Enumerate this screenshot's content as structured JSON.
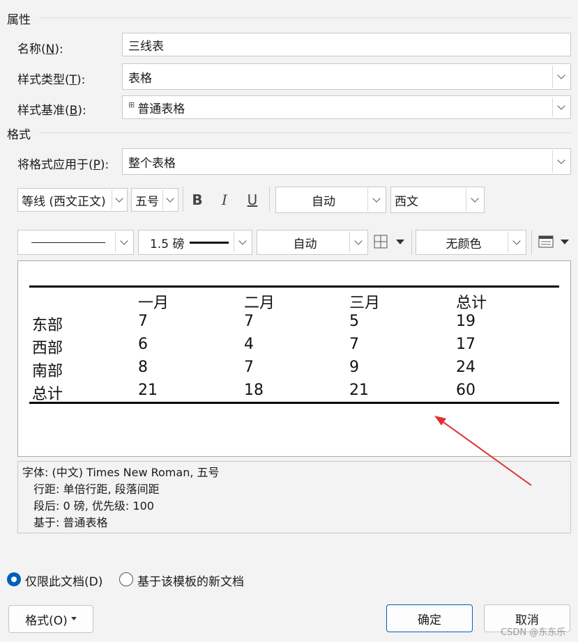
{
  "properties": {
    "section_title": "属性",
    "name_label_pre": "名称(",
    "name_label_key": "N",
    "name_label_post": "):",
    "name_value": "三线表",
    "type_label_pre": "样式类型(",
    "type_label_key": "T",
    "type_label_post": "):",
    "type_value": "表格",
    "based_label_pre": "样式基准(",
    "based_label_key": "B",
    "based_label_post": "):",
    "based_value": "普通表格"
  },
  "format": {
    "section_title": "格式",
    "apply_label_pre": "将格式应用于(",
    "apply_label_key": "P",
    "apply_label_post": "):",
    "apply_value": "整个表格",
    "font_name": "等线 (西文正文)",
    "font_size": "五号",
    "bold": "B",
    "italic": "I",
    "underline": "U",
    "font_color": "自动",
    "script": "西文",
    "border_width": "1.5 磅",
    "border_color": "自动",
    "shading": "无颜色"
  },
  "preview_table": {
    "headers": [
      "",
      "一月",
      "二月",
      "三月",
      "总计"
    ],
    "rows": [
      [
        "东部",
        "7",
        "7",
        "5",
        "19"
      ],
      [
        "西部",
        "6",
        "4",
        "7",
        "17"
      ],
      [
        "南部",
        "8",
        "7",
        "9",
        "24"
      ],
      [
        "总计",
        "21",
        "18",
        "21",
        "60"
      ]
    ]
  },
  "description": {
    "line1": "字体: (中文) Times New Roman, 五号",
    "line2": "行距: 单倍行距, 段落间距",
    "line3": "段后: 0 磅, 优先级: 100",
    "line4": "基于: 普通表格"
  },
  "scope": {
    "option1": "仅限此文档(D)",
    "option2": "基于该模板的新文档",
    "selected": "option1"
  },
  "buttons": {
    "format": "格式(O)",
    "ok": "确定",
    "cancel": "取消"
  },
  "watermark": "CSDN @东东乐",
  "colors": {
    "accent": "#005fb8",
    "arrow": "#e03030"
  }
}
